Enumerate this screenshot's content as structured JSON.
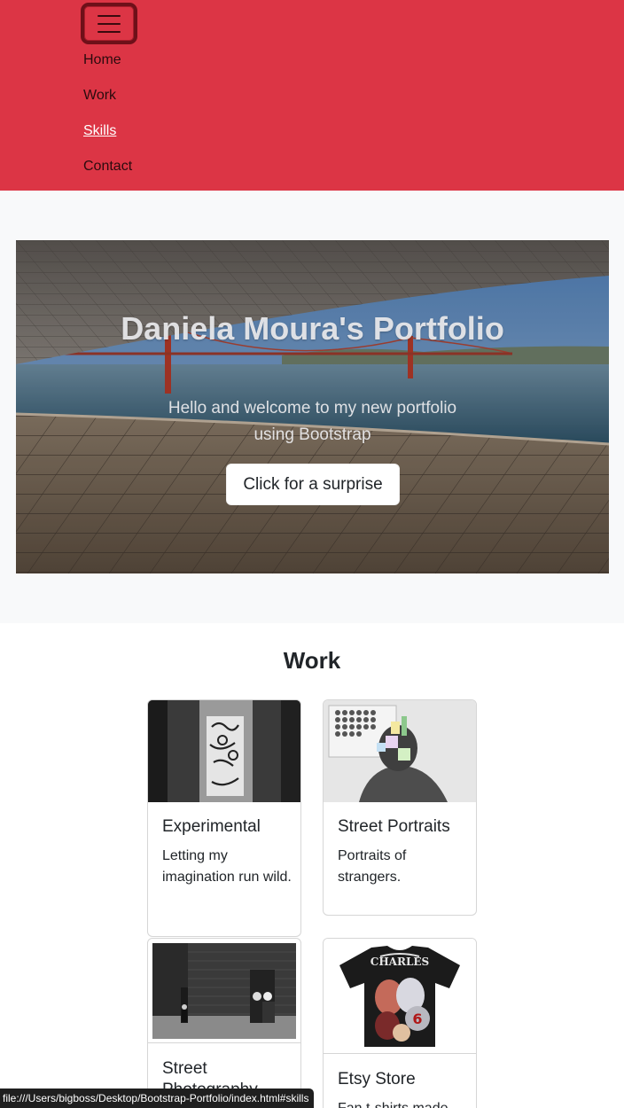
{
  "navbar": {
    "items": [
      {
        "label": "Home"
      },
      {
        "label": "Work"
      },
      {
        "label": "Skills"
      },
      {
        "label": "Contact"
      }
    ],
    "active_item": "Skills",
    "background_color": "#dc3545",
    "toggler_icon": "hamburger-menu-icon"
  },
  "hero": {
    "title": "Daniela Moura's Portfolio",
    "subtitle": "Hello and welcome to my new portfolio using Bootstrap",
    "button_label": "Click for a surprise"
  },
  "work": {
    "title": "Work",
    "cards": [
      {
        "title": "Experimental",
        "text": "Letting my imagination run wild."
      },
      {
        "title": "Street Portraits",
        "text": "Portraits of strangers."
      },
      {
        "title": "Street Photography",
        "text": ""
      },
      {
        "title": "Etsy Store",
        "text": "Fan t-shirts made"
      }
    ]
  },
  "status_bar": {
    "url": "file:///Users/bigboss/Desktop/Bootstrap-Portfolio/index.html#skills"
  }
}
